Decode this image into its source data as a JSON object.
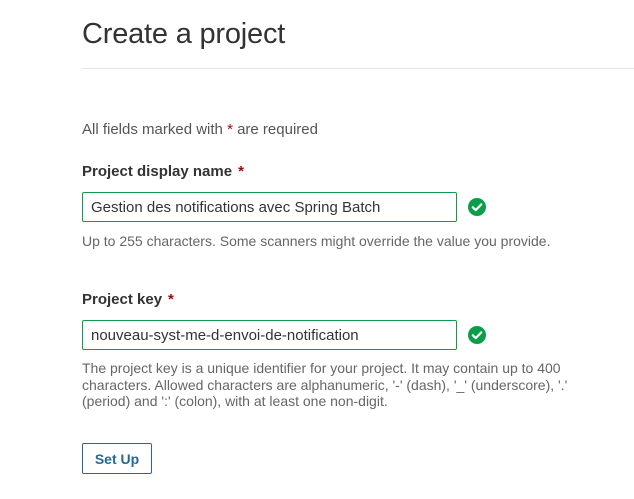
{
  "page": {
    "title": "Create a project"
  },
  "form": {
    "required_note_prefix": "All fields marked with",
    "required_marker": "*",
    "required_note_suffix": "are required",
    "display_name": {
      "label": "Project display name",
      "required_marker": "*",
      "value": "Gestion des notifications avec Spring Batch",
      "valid": true,
      "help": "Up to 255 characters. Some scanners might override the value you provide."
    },
    "project_key": {
      "label": "Project key",
      "required_marker": "*",
      "value": "nouveau-syst-me-d-envoi-de-notification",
      "valid": true,
      "help": "The project key is a unique identifier for your project. It may contain up to 400 characters. Allowed characters are alphanumeric, '-' (dash), '_' (underscore), '.' (period) and ':' (colon), with at least one non-digit."
    },
    "submit_label": "Set Up"
  },
  "icons": {
    "valid": "check-circle-icon"
  },
  "colors": {
    "valid_green": "#0a9e4a",
    "required_star": "#a4030f",
    "button_blue": "#236a97"
  }
}
